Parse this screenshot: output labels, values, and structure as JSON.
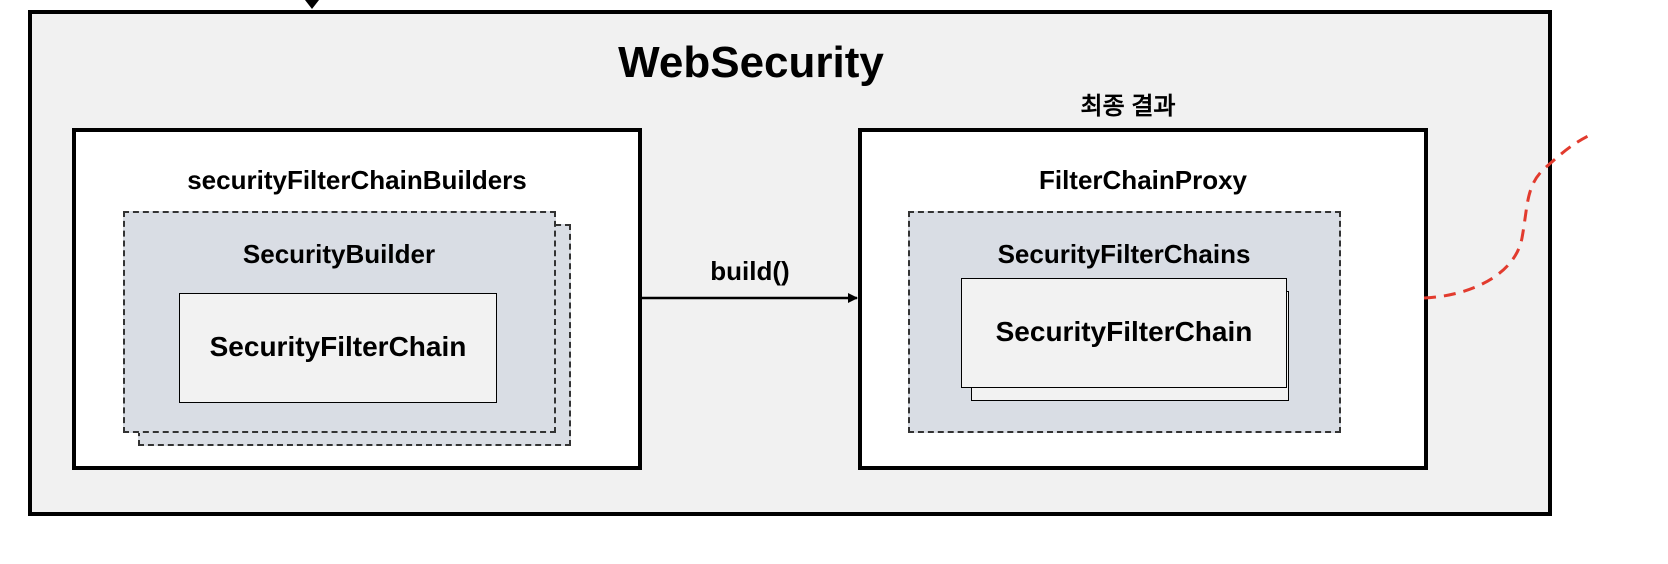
{
  "diagram": {
    "outer_title": "WebSecurity",
    "left_panel": {
      "header": "securityFilterChainBuilders",
      "builder_label": "SecurityBuilder",
      "chain_label": "SecurityFilterChain"
    },
    "right_panel": {
      "caption": "최종 결과",
      "header": "FilterChainProxy",
      "chains_label": "SecurityFilterChains",
      "chain_label": "SecurityFilterChain"
    },
    "arrow_label": "build()"
  },
  "colors": {
    "outer_bg": "#f1f1f1",
    "dashed_fill": "#d9dde4",
    "curve": "#e23b2e"
  }
}
